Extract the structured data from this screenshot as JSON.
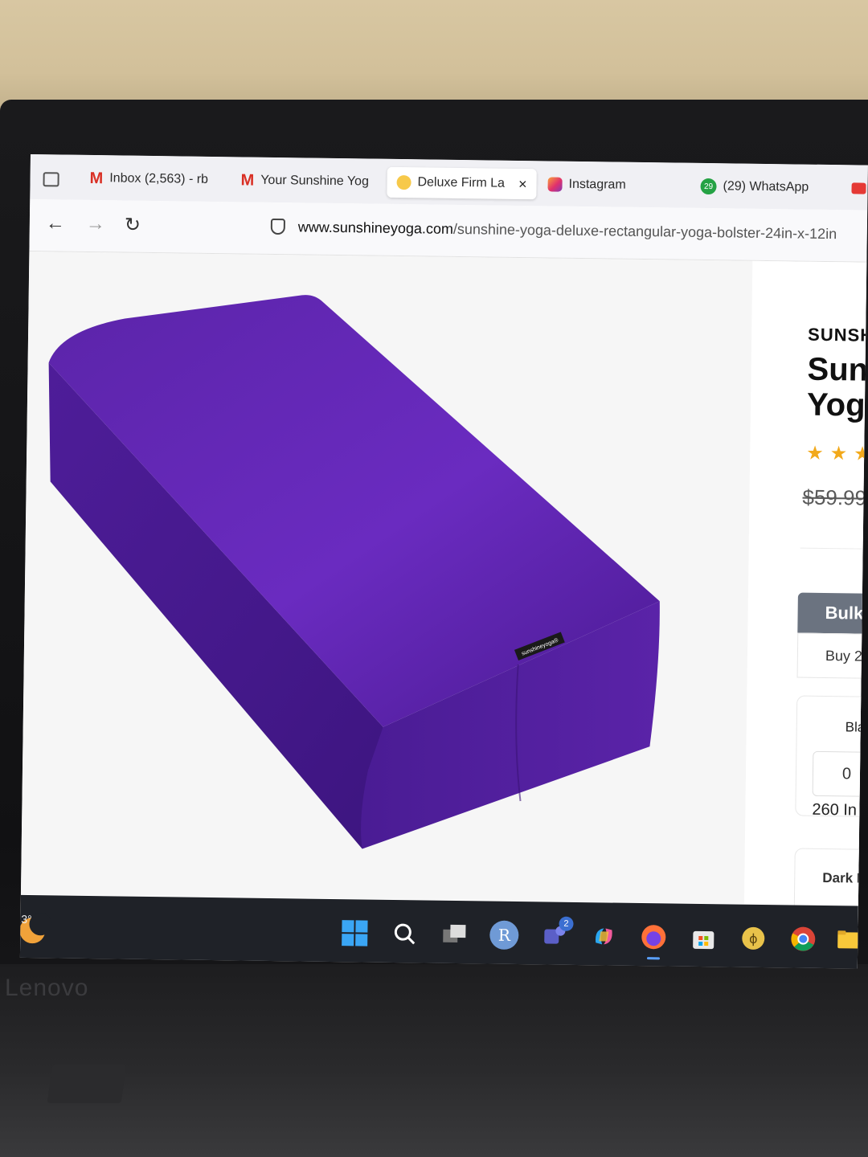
{
  "device": {
    "brand_label": "Lenovo"
  },
  "browser": {
    "tabs": [
      {
        "label": "Inbox (2,563) - rb",
        "icon": "gmail-icon"
      },
      {
        "label": "Your Sunshine Yog",
        "icon": "gmail-icon"
      },
      {
        "label": "Deluxe Firm La",
        "icon": "sunshine-logo-icon",
        "active": true,
        "close": "×"
      },
      {
        "label": "Instagram",
        "icon": "instagram-icon"
      },
      {
        "label": "(29) WhatsApp",
        "icon": "whatsapp-icon",
        "badge": "29"
      }
    ],
    "nav": {
      "back": "←",
      "forward": "→",
      "reload": "↻"
    },
    "url": {
      "domain": "www.sunshineyoga.com",
      "path": "/sunshine-yoga-deluxe-rectangular-yoga-bolster-24in-x-12in"
    }
  },
  "product": {
    "brand": "SUNSH",
    "title_line1": "Suns",
    "title_line2": "Yoga",
    "stars": "★★★",
    "price": "$59.99",
    "label_text": "sunshineyoga®",
    "bulk_header": "Bulk",
    "bulk_row": "Buy 2",
    "variant1_label": "Bla",
    "variant1_qty": "0",
    "variant1_stock": "260 In",
    "variant2_label": "Dark P"
  },
  "taskbar": {
    "weather_temp": "23°",
    "avatar_letter": "R",
    "teams_badge": "2"
  },
  "colors": {
    "bolster": "#5a22a8",
    "star": "#f2a91b",
    "taskbar": "#1f2228",
    "bulk_header": "#6b7380"
  }
}
